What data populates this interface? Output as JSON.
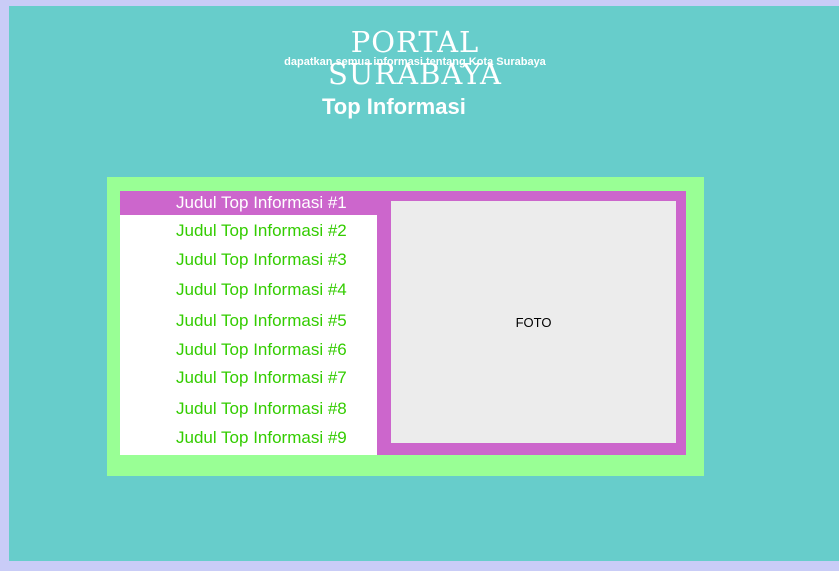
{
  "header": {
    "title": "PORTAL SURABAYA",
    "tagline": "dapatkan semua informasi tentang Kota Surabaya"
  },
  "section": {
    "heading": "Top Informasi"
  },
  "top_list": {
    "active_index": 0,
    "items": [
      "Judul Top Informasi #1",
      "Judul Top Informasi #2",
      "Judul Top Informasi #3",
      "Judul Top Informasi #4",
      "Judul Top Informasi #5",
      "Judul Top Informasi #6",
      "Judul Top Informasi #7",
      "Judul Top Informasi #8",
      "Judul Top Informasi #9"
    ]
  },
  "photo": {
    "label": "FOTO"
  },
  "colors": {
    "page_bg": "#67cdcb",
    "outer_bg": "#c9ccf7",
    "panel_bg": "#99ff95",
    "accent": "#cc66cc",
    "link_text": "#33cc00",
    "photo_bg": "#ececec"
  }
}
